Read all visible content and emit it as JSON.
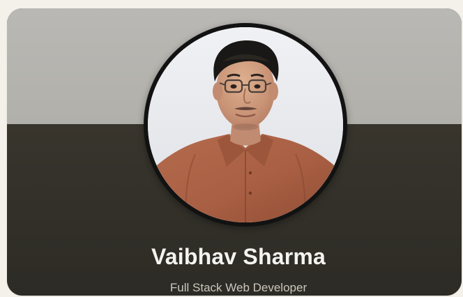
{
  "profile": {
    "name": "Vaibhav Sharma",
    "title": "Full Stack Web Developer"
  },
  "colors": {
    "page_background": "#f4f1ea",
    "cover_background": "#b5b4af",
    "card_background": "#2d2b25",
    "avatar_border": "#121212",
    "name_text": "#f5f3ef",
    "title_text": "#cbc7bf"
  }
}
